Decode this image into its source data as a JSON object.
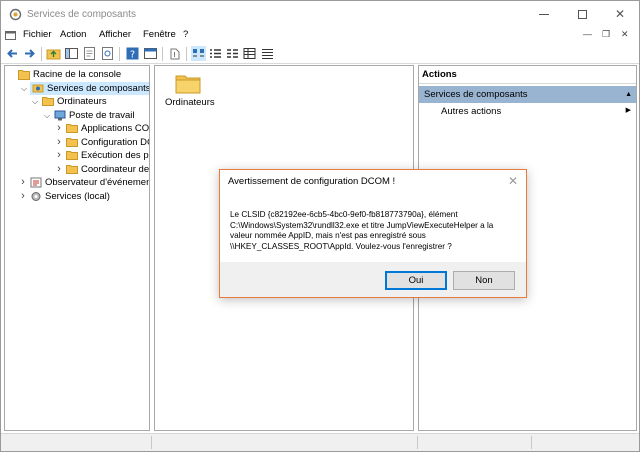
{
  "window": {
    "title": "Services de composants"
  },
  "menu": [
    "Fichier",
    "Action",
    "Afficher",
    "Fenêtre",
    "?"
  ],
  "tree": [
    {
      "label": "Racine de la console",
      "level": 0,
      "twisty": "",
      "icon": "console-root-icon"
    },
    {
      "label": "Services de composants",
      "level": 1,
      "twisty": "expanded",
      "icon": "component-services-icon",
      "selected": true
    },
    {
      "label": "Ordinateurs",
      "level": 2,
      "twisty": "expanded",
      "icon": "folder-icon"
    },
    {
      "label": "Poste de travail",
      "level": 3,
      "twisty": "expanded",
      "icon": "computer-icon"
    },
    {
      "label": "Applications COM",
      "level": 4,
      "twisty": "collapsed",
      "icon": "folder-icon"
    },
    {
      "label": "Configuration DC",
      "level": 4,
      "twisty": "collapsed",
      "icon": "folder-icon"
    },
    {
      "label": "Exécution des pro",
      "level": 4,
      "twisty": "collapsed",
      "icon": "folder-icon"
    },
    {
      "label": "Coordinateur de t",
      "level": 4,
      "twisty": "collapsed",
      "icon": "folder-icon"
    },
    {
      "label": "Observateur d'événements (",
      "level": 1,
      "twisty": "collapsed",
      "icon": "event-viewer-icon"
    },
    {
      "label": "Services (local)",
      "level": 1,
      "twisty": "collapsed",
      "icon": "services-gear-icon"
    }
  ],
  "center": {
    "items": [
      "Ordinateurs"
    ]
  },
  "actions": {
    "header": "Actions",
    "section": "Services de composants",
    "items": [
      "Autres actions"
    ]
  },
  "dialog": {
    "title": "Avertissement de configuration DCOM !",
    "message_lines": [
      "Le CLSID {c82192ee-6cb5-4bc0-9ef0-fb818773790a}, élément",
      "C:\\Windows\\System32\\rundll32.exe et titre JumpViewExecuteHelper a la",
      "valeur nommée AppID, mais n'est pas enregistré sous",
      "\\\\HKEY_CLASSES_ROOT\\AppId. Voulez-vous l'enregistrer ?"
    ],
    "yes_label": "Oui",
    "no_label": "Non"
  },
  "colors": {
    "selection": "#cce8ff",
    "actions_section": "#99b4d1",
    "dialog_border": "#e87a3c",
    "default_button_border": "#0078d7"
  }
}
